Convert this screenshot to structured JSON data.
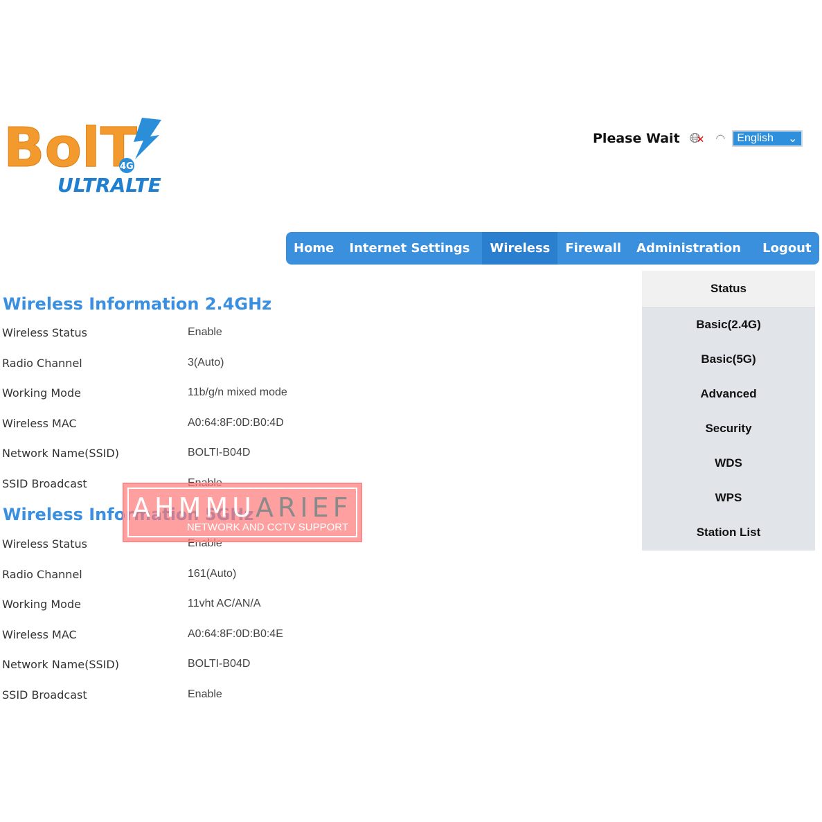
{
  "header": {
    "logo_text": "BOLT! 4G+ ULTRA LTE",
    "status": "Please Wait",
    "language": "English"
  },
  "nav": [
    "Home",
    "Internet Settings",
    "Wireless",
    "Firewall",
    "Administration",
    "Logout"
  ],
  "sidebar": [
    "Status",
    "Basic(2.4G)",
    "Basic(5G)",
    "Advanced",
    "Security",
    "WDS",
    "WPS",
    "Station List"
  ],
  "wifi24": {
    "title": "Wireless Information 2.4GHz",
    "rows": [
      {
        "label": "Wireless Status",
        "value": "Enable"
      },
      {
        "label": "Radio Channel",
        "value": "3(Auto)"
      },
      {
        "label": "Working Mode",
        "value": "11b/g/n mixed mode"
      },
      {
        "label": "Wireless MAC",
        "value": "A0:64:8F:0D:B0:4D"
      },
      {
        "label": "Network Name(SSID)",
        "value": "BOLTI-B04D"
      },
      {
        "label": "SSID Broadcast",
        "value": "Enable"
      }
    ]
  },
  "wifi5": {
    "title": "Wireless Information 5GHz",
    "rows": [
      {
        "label": "Wireless Status",
        "value": "Enable"
      },
      {
        "label": "Radio Channel",
        "value": "161(Auto)"
      },
      {
        "label": "Working Mode",
        "value": "11vht AC/AN/A"
      },
      {
        "label": "Wireless MAC",
        "value": "A0:64:8F:0D:B0:4E"
      },
      {
        "label": "Network Name(SSID)",
        "value": "BOLTI-B04D"
      },
      {
        "label": "SSID Broadcast",
        "value": "Enable"
      }
    ]
  },
  "watermark": {
    "a": "AHMMU",
    "b": "ARIEF",
    "sub": "NETWORK  AND CCTV SUPPORT"
  }
}
